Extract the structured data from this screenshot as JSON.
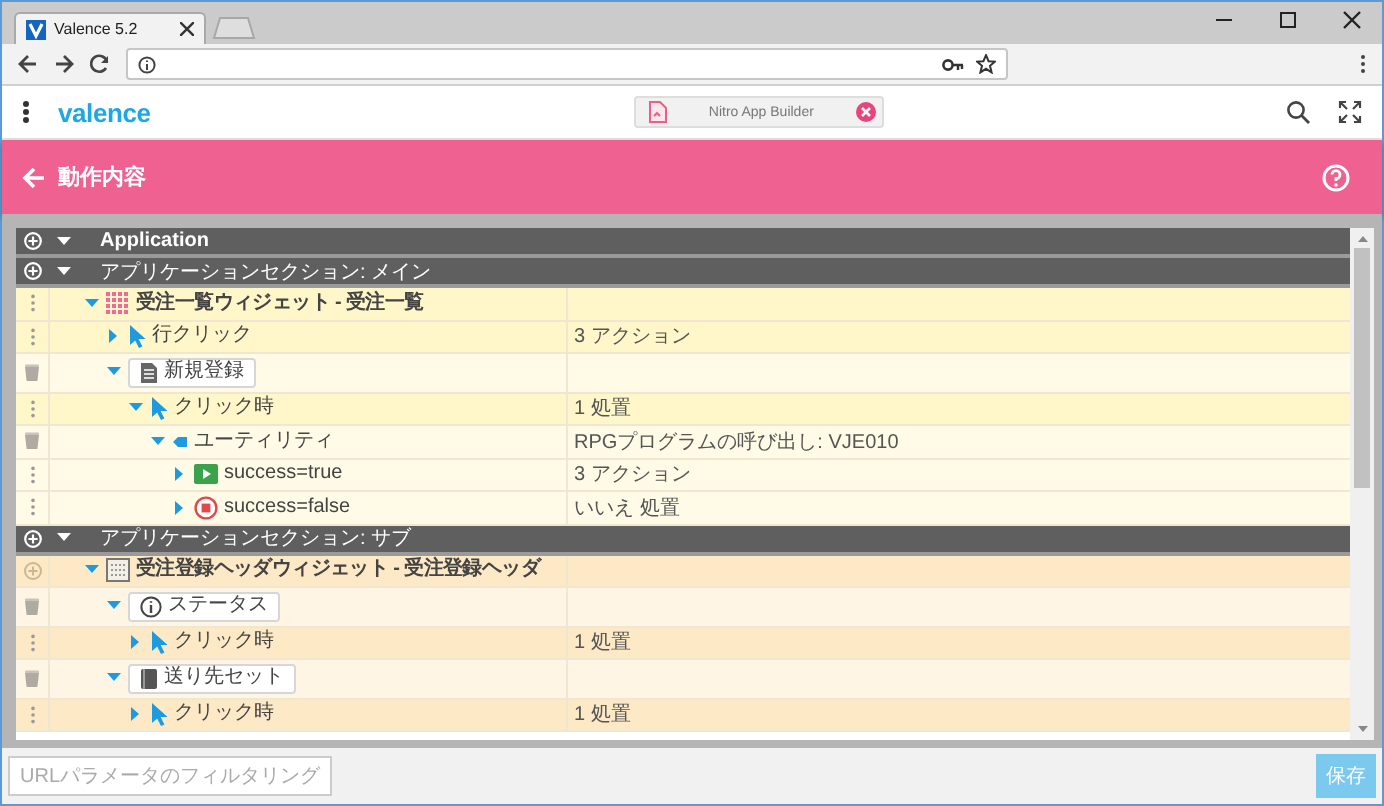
{
  "browser": {
    "tab_title": "Valence 5.2"
  },
  "app_bar": {
    "logo": "valence",
    "open_app": "Nitro App Builder"
  },
  "page_header": {
    "title": "動作内容"
  },
  "tree": [
    {
      "kind": "root",
      "label": "Application",
      "expanded": true,
      "children": [
        {
          "kind": "section",
          "label": "アプリケーションセクション: メイン",
          "expanded": true,
          "color": "#fff7c9",
          "children": [
            {
              "kind": "grid",
              "label": "受注一覧ウィジェット - 受注一覧",
              "removable": false,
              "shaded": true,
              "expanded": true,
              "children": [
                {
                  "kind": "event",
                  "label": "行クリック",
                  "value": "3 アクション",
                  "removable": false,
                  "shaded": true,
                  "expanded": false
                },
                {
                  "kind": "docbutton",
                  "label": "新規登録",
                  "removable": true,
                  "shaded": false,
                  "expanded": true,
                  "children": [
                    {
                      "kind": "event",
                      "label": "クリック時",
                      "value": "1 処置",
                      "removable": false,
                      "shaded": true,
                      "expanded": true,
                      "children": [
                        {
                          "kind": "utility",
                          "label": "ユーティリティ",
                          "value": "RPGプログラムの呼び出し: VJE010",
                          "removable": true,
                          "shaded": false,
                          "expanded": true,
                          "children": [
                            {
                              "kind": "success",
                              "label": "success=true",
                              "value": "3 アクション",
                              "removable": false,
                              "shaded": false,
                              "expanded": false
                            },
                            {
                              "kind": "failure",
                              "label": "success=false",
                              "value": "いいえ 処置",
                              "removable": false,
                              "shaded": false,
                              "expanded": false
                            }
                          ]
                        }
                      ]
                    }
                  ]
                }
              ]
            }
          ]
        },
        {
          "kind": "section",
          "label": "アプリケーションセクション: サブ",
          "expanded": true,
          "color": "#fde9c6",
          "children": [
            {
              "kind": "form",
              "label": "受注登録ヘッダウィジェット - 受注登録ヘッダ",
              "removable": false,
              "shaded": true,
              "expanded": true,
              "children": [
                {
                  "kind": "infobutton",
                  "label": "ステータス",
                  "removable": true,
                  "shaded": false,
                  "expanded": true,
                  "children": [
                    {
                      "kind": "event",
                      "label": "クリック時",
                      "value": "1 処置",
                      "removable": false,
                      "shaded": true,
                      "expanded": false
                    }
                  ]
                },
                {
                  "kind": "bookbutton",
                  "label": "送り先セット",
                  "removable": true,
                  "shaded": false,
                  "expanded": true,
                  "children": [
                    {
                      "kind": "event",
                      "label": "クリック時",
                      "value": "1 処置",
                      "removable": false,
                      "shaded": true,
                      "expanded": false
                    }
                  ]
                }
              ]
            }
          ]
        }
      ]
    }
  ],
  "footer": {
    "filter_button": {
      "label": "URLパラメータのフィルタリング",
      "disabled": true
    },
    "save_button": {
      "label": "保存",
      "disabled": true
    }
  }
}
